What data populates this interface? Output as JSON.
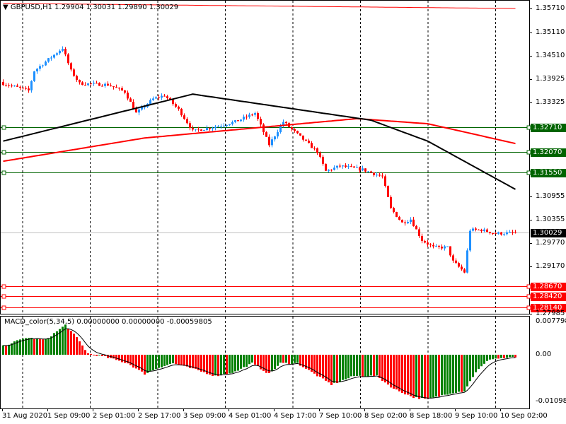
{
  "header": {
    "symbol": "GBPUSD,H1",
    "open": "1.29904",
    "high": "1.30031",
    "low": "1.29890",
    "close": "1.30029"
  },
  "macd_header": {
    "name": "MACD_color(5,34,5)",
    "v1": "0.00000000",
    "v2": "0.00000000",
    "v3": "-0.00059805"
  },
  "price_axis": [
    "1.35710",
    "1.35110",
    "1.34510",
    "1.33925",
    "1.33325",
    "1.30955",
    "1.30355",
    "1.29770",
    "1.29170",
    "1.27985"
  ],
  "macd_axis": [
    "0.0077984",
    "0.00",
    "-0.010988"
  ],
  "levels": [
    {
      "price": "1.32710",
      "color": "#006400"
    },
    {
      "price": "1.32070",
      "color": "#006400"
    },
    {
      "price": "1.31550",
      "color": "#006400"
    },
    {
      "price": "1.28670",
      "color": "#ff0000"
    },
    {
      "price": "1.28420",
      "color": "#ff0000"
    },
    {
      "price": "1.28140",
      "color": "#ff0000"
    }
  ],
  "bid": {
    "price": "1.30029",
    "color": "#000000"
  },
  "time_axis": [
    "31 Aug 2020",
    "1 Sep 09:00",
    "2 Sep 01:00",
    "2 Sep 17:00",
    "3 Sep 09:00",
    "4 Sep 01:00",
    "4 Sep 17:00",
    "7 Sep 10:00",
    "8 Sep 02:00",
    "8 Sep 18:00",
    "9 Sep 10:00",
    "10 Sep 02:00"
  ],
  "colors": {
    "bull": "#1e90ff",
    "bear": "#ff0000",
    "ma_slow": "#000000",
    "ma_red": "#ff0000",
    "hist_up": "#008000",
    "hist_down": "#ff0000"
  },
  "chart_data": {
    "type": "candlestick",
    "title": "GBPUSD,H1",
    "bars": 182,
    "ylim": [
      1.27985,
      1.3571
    ],
    "close_path": [
      [
        0,
        1.3381
      ],
      [
        9,
        1.3363
      ],
      [
        11,
        1.3413
      ],
      [
        21,
        1.3471
      ],
      [
        24,
        1.3413
      ],
      [
        27,
        1.3381
      ],
      [
        37,
        1.3378
      ],
      [
        43,
        1.336
      ],
      [
        47,
        1.3306
      ],
      [
        53,
        1.3342
      ],
      [
        57,
        1.3351
      ],
      [
        62,
        1.3315
      ],
      [
        67,
        1.3261
      ],
      [
        74,
        1.327
      ],
      [
        82,
        1.3284
      ],
      [
        89,
        1.3306
      ],
      [
        94,
        1.3226
      ],
      [
        99,
        1.3284
      ],
      [
        104,
        1.3252
      ],
      [
        111,
        1.3208
      ],
      [
        114,
        1.3159
      ],
      [
        119,
        1.3172
      ],
      [
        127,
        1.3163
      ],
      [
        134,
        1.3145
      ],
      [
        137,
        1.3064
      ],
      [
        141,
        1.3028
      ],
      [
        144,
        1.3037
      ],
      [
        148,
        1.2984
      ],
      [
        152,
        1.2966
      ],
      [
        157,
        1.2966
      ],
      [
        159,
        1.293
      ],
      [
        163,
        1.2903
      ],
      [
        165,
        1.301
      ],
      [
        169,
        1.301
      ],
      [
        174,
        1.3001
      ],
      [
        181,
        1.30029
      ]
    ],
    "ma_black": [
      [
        0,
        1.3235
      ],
      [
        67,
        1.3354
      ],
      [
        130,
        1.3288
      ],
      [
        150,
        1.3235
      ],
      [
        181,
        1.3113
      ]
    ],
    "ma_red": [
      [
        0,
        1.3184
      ],
      [
        50,
        1.3243
      ],
      [
        125,
        1.3292
      ],
      [
        150,
        1.3279
      ],
      [
        181,
        1.3229
      ]
    ],
    "ma_red_top": [
      [
        0,
        1.3584
      ],
      [
        181,
        1.3571
      ]
    ],
    "macd": {
      "ylim": [
        -0.010988,
        0.0077984
      ],
      "hist_path": [
        [
          0,
          0.002
        ],
        [
          8,
          0.004
        ],
        [
          15,
          0.0035
        ],
        [
          22,
          0.007
        ],
        [
          26,
          0.004
        ],
        [
          30,
          0.0003
        ],
        [
          36,
          -0.0005
        ],
        [
          44,
          -0.002
        ],
        [
          50,
          -0.0045
        ],
        [
          55,
          -0.003
        ],
        [
          60,
          -0.002
        ],
        [
          68,
          -0.0035
        ],
        [
          75,
          -0.005
        ],
        [
          82,
          -0.004
        ],
        [
          88,
          -0.002
        ],
        [
          94,
          -0.0045
        ],
        [
          98,
          -0.002
        ],
        [
          104,
          -0.002
        ],
        [
          110,
          -0.0045
        ],
        [
          116,
          -0.007
        ],
        [
          124,
          -0.005
        ],
        [
          132,
          -0.005
        ],
        [
          138,
          -0.008
        ],
        [
          145,
          -0.01
        ],
        [
          150,
          -0.0105
        ],
        [
          158,
          -0.009
        ],
        [
          163,
          -0.0085
        ],
        [
          167,
          -0.004
        ],
        [
          172,
          -0.001
        ],
        [
          181,
          -0.0006
        ]
      ]
    }
  }
}
